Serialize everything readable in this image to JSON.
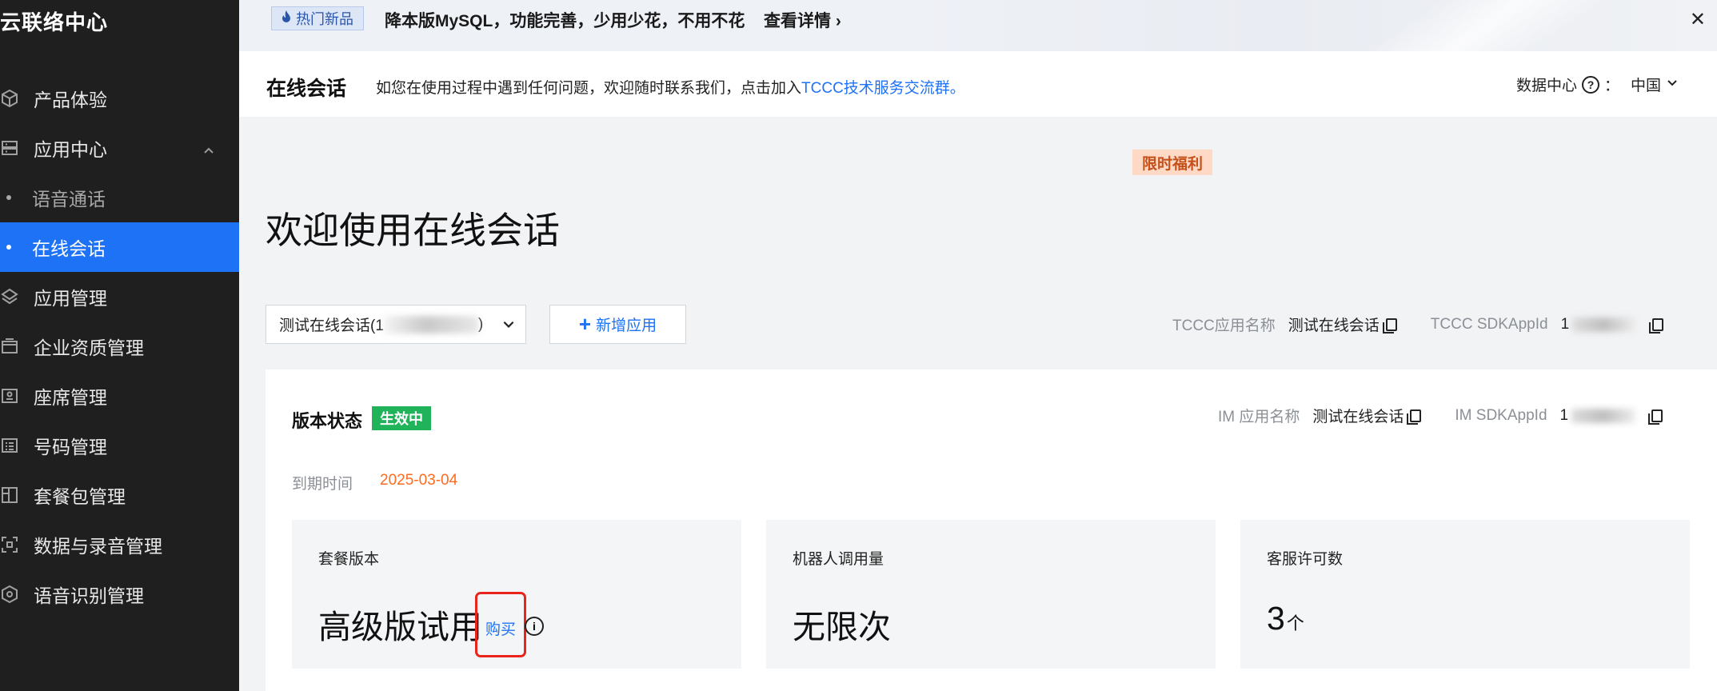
{
  "sidebar": {
    "brand": "云联络中心",
    "items": [
      {
        "label": "产品体验",
        "icon": "cube-icon"
      },
      {
        "label": "应用中心",
        "icon": "server-icon",
        "expanded": true
      },
      {
        "label": "语音通话",
        "sub": true
      },
      {
        "label": "在线会话",
        "sub": true,
        "active": true
      },
      {
        "label": "应用管理",
        "icon": "layers-icon"
      },
      {
        "label": "企业资质管理",
        "icon": "wallet-icon"
      },
      {
        "label": "座席管理",
        "icon": "agent-card-icon"
      },
      {
        "label": "号码管理",
        "icon": "number-list-icon"
      },
      {
        "label": "套餐包管理",
        "icon": "package-icon"
      },
      {
        "label": "数据与录音管理",
        "icon": "scan-icon"
      },
      {
        "label": "语音识别管理",
        "icon": "voice-recognition-icon"
      }
    ]
  },
  "banner": {
    "badge": "热门新品",
    "text": "降本版MySQL，功能完善，少用少花，不用不花",
    "link": "查看详情 ›",
    "close": "✕"
  },
  "header": {
    "title": "在线会话",
    "desc_prefix": "如您在使用过程中遇到任何问题，欢迎随时联系我们，点击加入",
    "desc_link": "TCCC技术服务交流群。",
    "datacenter_label": "数据中心",
    "datacenter_colon": "：",
    "region": "中国"
  },
  "welcome": "欢迎使用在线会话",
  "app_select": {
    "prefix": "测试在线会话(1",
    "suffix": ")"
  },
  "add_app": "新增应用",
  "tccc": {
    "name_label": "TCCC应用名称",
    "name_value": "测试在线会话",
    "sdk_label": "TCCC SDKAppId",
    "sdk_value_prefix": "1"
  },
  "im": {
    "name_label": "IM 应用名称",
    "name_value": "测试在线会话",
    "sdk_label": "IM SDKAppId",
    "sdk_value_prefix": "1"
  },
  "version": {
    "title": "版本状态",
    "status": "生效中",
    "expire_label": "到期时间",
    "expire_date": "2025-03-04"
  },
  "stats": {
    "plan": {
      "label": "套餐版本",
      "value": "高级版试用",
      "buy": "购买"
    },
    "robot": {
      "label": "机器人调用量",
      "value": "无限次",
      "promo": "限时福利"
    },
    "seats": {
      "label": "客服许可数",
      "value": "3",
      "unit": "个"
    }
  },
  "colors": {
    "accent": "#1e72f5",
    "success": "#20b35a",
    "warning": "#ff6a1f",
    "sidebar_bg": "#1f1f1f"
  }
}
